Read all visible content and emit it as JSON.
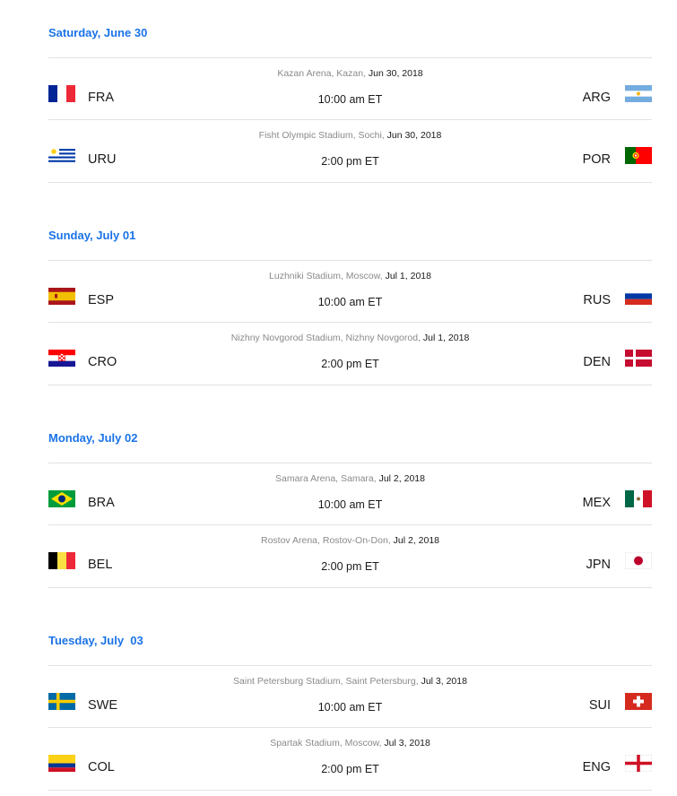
{
  "days": [
    {
      "title": "Saturday, June 30",
      "matches": [
        {
          "venue": "Kazan Arena, Kazan,",
          "date": "Jun 30, 2018",
          "time": "10:00 am ET",
          "home": "FRA",
          "away": "ARG",
          "home_flag": "france-flag-icon",
          "away_flag": "argentina-flag-icon"
        },
        {
          "venue": "Fisht Olympic Stadium, Sochi,",
          "date": "Jun 30, 2018",
          "time": "2:00 pm ET",
          "home": "URU",
          "away": "POR",
          "home_flag": "uruguay-flag-icon",
          "away_flag": "portugal-flag-icon"
        }
      ]
    },
    {
      "title": "Sunday, July 01",
      "matches": [
        {
          "venue": "Luzhniki Stadium, Moscow,",
          "date": "Jul 1, 2018",
          "time": "10:00 am ET",
          "home": "ESP",
          "away": "RUS",
          "home_flag": "spain-flag-icon",
          "away_flag": "russia-flag-icon"
        },
        {
          "venue": "Nizhny Novgorod Stadium, Nizhny Novgorod,",
          "date": "Jul 1, 2018",
          "time": "2:00 pm ET",
          "home": "CRO",
          "away": "DEN",
          "home_flag": "croatia-flag-icon",
          "away_flag": "denmark-flag-icon"
        }
      ]
    },
    {
      "title": "Monday, July 02",
      "matches": [
        {
          "venue": "Samara Arena, Samara,",
          "date": "Jul 2, 2018",
          "time": "10:00 am ET",
          "home": "BRA",
          "away": "MEX",
          "home_flag": "brazil-flag-icon",
          "away_flag": "mexico-flag-icon"
        },
        {
          "venue": "Rostov Arena, Rostov-On-Don,",
          "date": "Jul 2, 2018",
          "time": "2:00 pm ET",
          "home": "BEL",
          "away": "JPN",
          "home_flag": "belgium-flag-icon",
          "away_flag": "japan-flag-icon"
        }
      ]
    },
    {
      "title": "Tuesday, July  03",
      "matches": [
        {
          "venue": "Saint Petersburg Stadium, Saint Petersburg,",
          "date": "Jul 3, 2018",
          "time": "10:00 am ET",
          "home": "SWE",
          "away": "SUI",
          "home_flag": "sweden-flag-icon",
          "away_flag": "switzerland-flag-icon"
        },
        {
          "venue": "Spartak Stadium, Moscow,",
          "date": "Jul 3, 2018",
          "time": "2:00 pm ET",
          "home": "COL",
          "away": "ENG",
          "home_flag": "colombia-flag-icon",
          "away_flag": "england-flag-icon"
        }
      ]
    }
  ],
  "colors": {
    "day_title": "#1a73e8",
    "divider": "#e2e2e2",
    "venue": "#8a8a8a"
  }
}
